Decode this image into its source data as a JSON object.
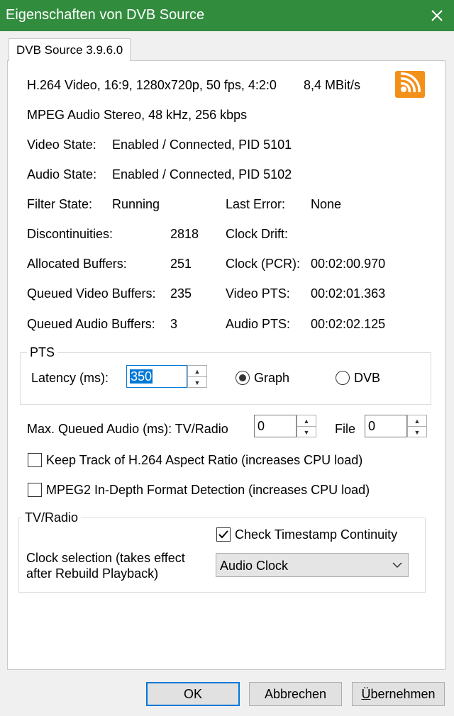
{
  "window": {
    "title": "Eigenschaften von DVB Source"
  },
  "tab": {
    "label": "DVB Source 3.9.6.0"
  },
  "info": {
    "video_format": "H.264 Video, 16:9, 1280x720p, 50 fps, 4:2:0",
    "bitrate": "8,4 MBit/s",
    "audio_format": "MPEG Audio Stereo, 48 kHz, 256 kbps",
    "video_state_label": "Video State:",
    "video_state_value": "Enabled / Connected, PID 5101",
    "audio_state_label": "Audio State:",
    "audio_state_value": "Enabled / Connected, PID 5102",
    "filter_state_label": "Filter State:",
    "filter_state_value": "Running",
    "last_error_label": "Last Error:",
    "last_error_value": "None",
    "discontinuities_label": "Discontinuities:",
    "discontinuities_value": "2818",
    "clock_drift_label": "Clock Drift:",
    "clock_drift_value": "",
    "allocated_buffers_label": "Allocated Buffers:",
    "allocated_buffers_value": "251",
    "clock_pcr_label": "Clock (PCR):",
    "clock_pcr_value": "00:02:00.970",
    "queued_video_label": "Queued Video Buffers:",
    "queued_video_value": "235",
    "video_pts_label": "Video PTS:",
    "video_pts_value": "00:02:01.363",
    "queued_audio_label": "Queued Audio Buffers:",
    "queued_audio_value": "3",
    "audio_pts_label": "Audio PTS:",
    "audio_pts_value": "00:02:02.125"
  },
  "pts": {
    "group_label": "PTS",
    "latency_label": "Latency (ms):",
    "latency_value": "350",
    "graph_label": "Graph",
    "dvb_label": "DVB",
    "selected": "Graph"
  },
  "queued_audio": {
    "label": "Max. Queued Audio (ms): TV/Radio",
    "tv_radio_value": "0",
    "file_label": "File",
    "file_value": "0"
  },
  "options": {
    "keep_track_label": "Keep Track of H.264 Aspect Ratio (increases CPU load)",
    "keep_track_checked": false,
    "mpeg2_label": "MPEG2 In-Depth Format Detection (increases CPU load)",
    "mpeg2_checked": false
  },
  "tv_radio": {
    "group_label": "TV/Radio",
    "check_timestamp_label": "Check Timestamp Continuity",
    "check_timestamp_checked": true,
    "clock_selection_label_line1": "Clock selection (takes effect",
    "clock_selection_label_line2": "after Rebuild Playback)",
    "clock_selection_value": "Audio Clock"
  },
  "buttons": {
    "ok": "OK",
    "cancel": "Abbrechen",
    "apply_underlined": "Ü",
    "apply_rest": "bernehmen"
  },
  "colors": {
    "titlebar": "#328c3e",
    "rss_icon": "#f39019",
    "focus": "#0078d7"
  }
}
